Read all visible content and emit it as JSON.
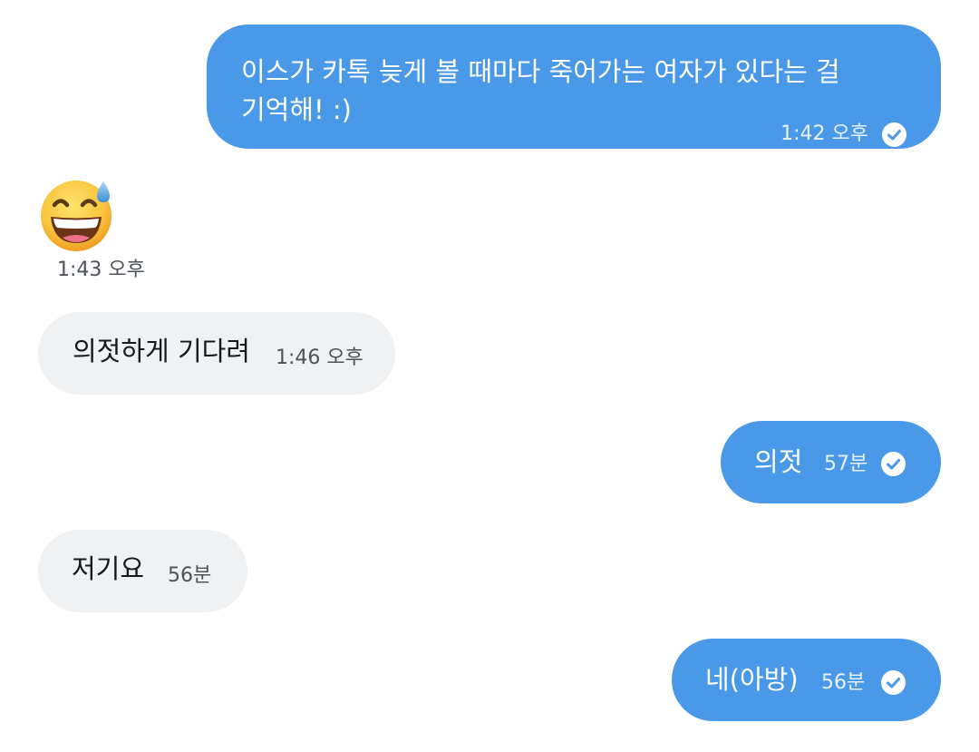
{
  "messages": [
    {
      "direction": "outgoing",
      "text": "이스가 카톡 늦게 볼 때마다 죽어가는 여자가 있다는 걸 기억해! :)",
      "time": "1:42 오후",
      "status": "read-check-icon"
    },
    {
      "direction": "incoming",
      "emoji": "😅",
      "emoji_name": "grinning-face-with-sweat-icon",
      "time": "1:43 오후"
    },
    {
      "direction": "incoming",
      "text": "의젓하게 기다려",
      "time": "1:46 오후"
    },
    {
      "direction": "outgoing",
      "text": "의젓",
      "time": "57분",
      "status": "read-check-icon"
    },
    {
      "direction": "incoming",
      "text": "저기요",
      "time": "56분"
    },
    {
      "direction": "outgoing",
      "text": "네(아방)",
      "time": "56분",
      "status": "read-check-icon"
    }
  ],
  "colors": {
    "outgoing_bubble": "#4a98e8",
    "incoming_bubble": "#eff1f3",
    "outgoing_text": "#ffffff",
    "incoming_text": "#16191c",
    "timestamp_incoming": "#4c5258"
  }
}
